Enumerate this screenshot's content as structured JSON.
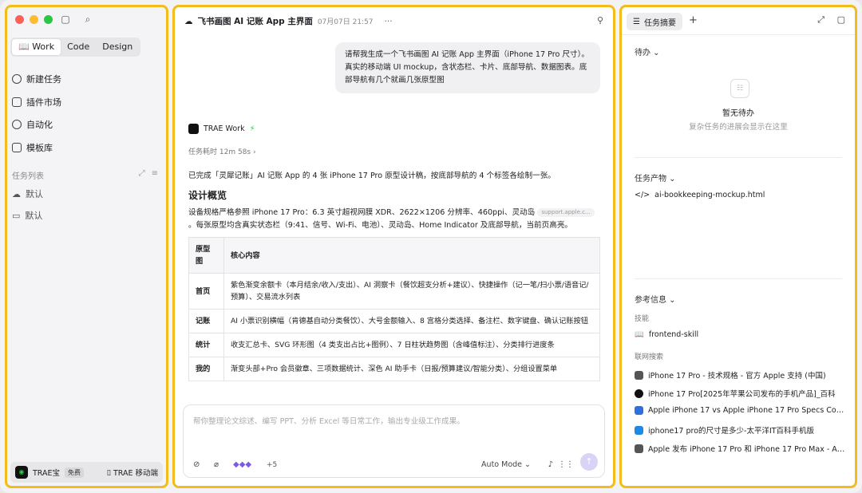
{
  "sidebar": {
    "modes": [
      "Work",
      "Code",
      "Design"
    ],
    "active_mode": "Work",
    "nav": [
      "新建任务",
      "插件市场",
      "自动化",
      "模板库"
    ],
    "task_list_label": "任务列表",
    "tasks": [
      "默认",
      "默认"
    ],
    "footer": {
      "name": "TRAE宝",
      "badge": "免费",
      "mobile": "TRAE 移动端"
    }
  },
  "main": {
    "title": "飞书画图 AI 记账 App 主界面",
    "date": "07月07日 21:57",
    "prompt": "请帮我生成一个飞书画图 AI 记账 App 主界面（iPhone 17 Pro 尺寸）。真实的移动端 UI mockup，含状态栏、卡片、底部导航、数据图表。底部导航有几个就画几张原型图",
    "agent": "TRAE Work",
    "elapsed": "任务耗时 12m 58s",
    "summary": "已完成「灵犀记账」AI 记账 App 的 4 张 iPhone 17 Pro 原型设计稿，按底部导航的 4 个标签各绘制一张。",
    "heading": "设计概览",
    "spec_a": "设备规格严格参照 iPhone 17 Pro：6.3 英寸超视网膜 XDR、2622×1206 分辨率、460ppi、灵动岛",
    "spec_source": "support.apple.c...",
    "spec_b": "。每张原型均含真实状态栏（9:41、信号、Wi-Fi、电池）、灵动岛、Home Indicator 及底部导航，当前页高亮。",
    "table": {
      "headers": [
        "原型图",
        "核心内容"
      ],
      "rows": [
        [
          "首页",
          "紫色渐变余额卡（本月结余/收入/支出）、AI 洞察卡（餐饮超支分析+建议）、快捷操作（记一笔/扫小票/语音记/预算）、交易流水列表"
        ],
        [
          "记账",
          "AI 小票识别横幅（肯德基自动分类餐饮）、大号金额输入、8 宫格分类选择、备注栏、数字键盘、确认记账按钮"
        ],
        [
          "统计",
          "收支汇总卡、SVG 环形图（4 类支出占比+图例）、7 日柱状趋势图（含峰值标注）、分类排行进度条"
        ],
        [
          "我的",
          "渐变头部+Pro 会员徽章、三项数据统计、深色 AI 助手卡（日报/预算建议/智能分类）、分组设置菜单"
        ]
      ]
    },
    "composer_placeholder": "帮你整理论文综述、编写 PPT、分析 Excel 等日常工作，输出专业级工作成果。",
    "plus_count": "+5",
    "mode": "Auto Mode"
  },
  "panel": {
    "tab": "任务摘要",
    "todo_label": "待办",
    "empty_title": "暂无待办",
    "empty_sub": "复杂任务的进展会显示在这里",
    "artifacts_label": "任务产物",
    "artifact": "ai-bookkeeping-mockup.html",
    "ref_label": "参考信息",
    "skills_label": "技能",
    "skill": "frontend-skill",
    "web_label": "联网搜索",
    "links": [
      "iPhone 17 Pro - 技术规格 - 官方 Apple 支持 (中国)",
      "iPhone 17 Pro[2025年苹果公司发布的手机产品]_百科",
      "Apple iPhone 17 vs Apple iPhone 17 Pro Specs Com...",
      "iphone17 pro的尺寸是多少-太平洋IT百科手机版",
      "Apple 发布 iPhone 17 Pro 和 iPhone 17 Pro Max - Ap..."
    ]
  }
}
